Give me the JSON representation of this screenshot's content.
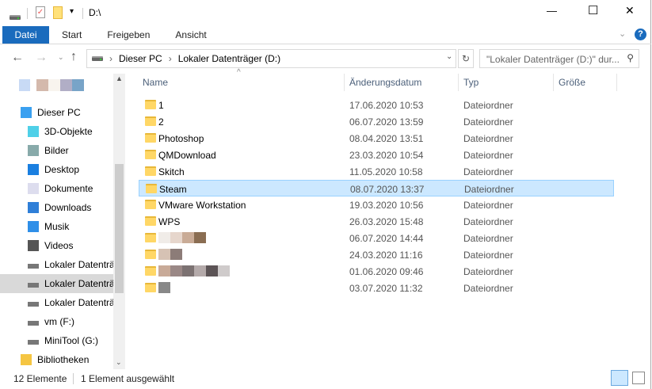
{
  "title": {
    "path": "D:\\"
  },
  "window_controls": {
    "minimize": "—",
    "maximize": "☐",
    "close": "✕"
  },
  "ribbon": {
    "tabs": [
      "Datei",
      "Start",
      "Freigeben",
      "Ansicht"
    ],
    "help": "?"
  },
  "address": {
    "crumbs": [
      "Dieser PC",
      "Lokaler Datenträger (D:)"
    ],
    "search_placeholder": "\"Lokaler Datenträger (D:)\" dur..."
  },
  "sidebar": {
    "items": [
      {
        "label": "Dieser PC",
        "icon": "pc-icon"
      },
      {
        "label": "3D-Objekte",
        "icon": "cube-icon"
      },
      {
        "label": "Bilder",
        "icon": "pictures-icon"
      },
      {
        "label": "Desktop",
        "icon": "desktop-icon"
      },
      {
        "label": "Dokumente",
        "icon": "document-icon"
      },
      {
        "label": "Downloads",
        "icon": "download-icon"
      },
      {
        "label": "Musik",
        "icon": "music-icon"
      },
      {
        "label": "Videos",
        "icon": "video-icon"
      },
      {
        "label": "Lokaler Datenträ",
        "icon": "windows-drive-icon"
      },
      {
        "label": "Lokaler Datenträ",
        "icon": "drive-icon",
        "selected": true
      },
      {
        "label": "Lokaler Datenträ",
        "icon": "drive-icon"
      },
      {
        "label": "vm (F:)",
        "icon": "drive-icon"
      },
      {
        "label": "MiniTool (G:)",
        "icon": "drive-icon"
      },
      {
        "label": "Bibliotheken",
        "icon": "library-icon"
      }
    ]
  },
  "columns": [
    "Name",
    "Änderungsdatum",
    "Typ",
    "Größe"
  ],
  "files": [
    {
      "name": "1",
      "date": "17.06.2020 10:53",
      "type": "Dateiordner"
    },
    {
      "name": "2",
      "date": "06.07.2020 13:59",
      "type": "Dateiordner"
    },
    {
      "name": "Photoshop",
      "date": "08.04.2020 13:51",
      "type": "Dateiordner"
    },
    {
      "name": "QMDownload",
      "date": "23.03.2020 10:54",
      "type": "Dateiordner"
    },
    {
      "name": "Skitch",
      "date": "11.05.2020 10:58",
      "type": "Dateiordner"
    },
    {
      "name": "Steam",
      "date": "08.07.2020 13:37",
      "type": "Dateiordner",
      "selected": true
    },
    {
      "name": "VMware Workstation",
      "date": "19.03.2020 10:56",
      "type": "Dateiordner"
    },
    {
      "name": "WPS",
      "date": "26.03.2020 15:48",
      "type": "Dateiordner"
    },
    {
      "name": "",
      "date": "06.07.2020 14:44",
      "type": "Dateiordner"
    },
    {
      "name": "",
      "date": "24.03.2020 11:16",
      "type": "Dateiordner"
    },
    {
      "name": "",
      "date": "01.06.2020 09:46",
      "type": "Dateiordner"
    },
    {
      "name": "",
      "date": "03.07.2020 11:32",
      "type": "Dateiordner"
    }
  ],
  "status": {
    "count": "12 Elemente",
    "selection": "1 Element ausgewählt"
  }
}
